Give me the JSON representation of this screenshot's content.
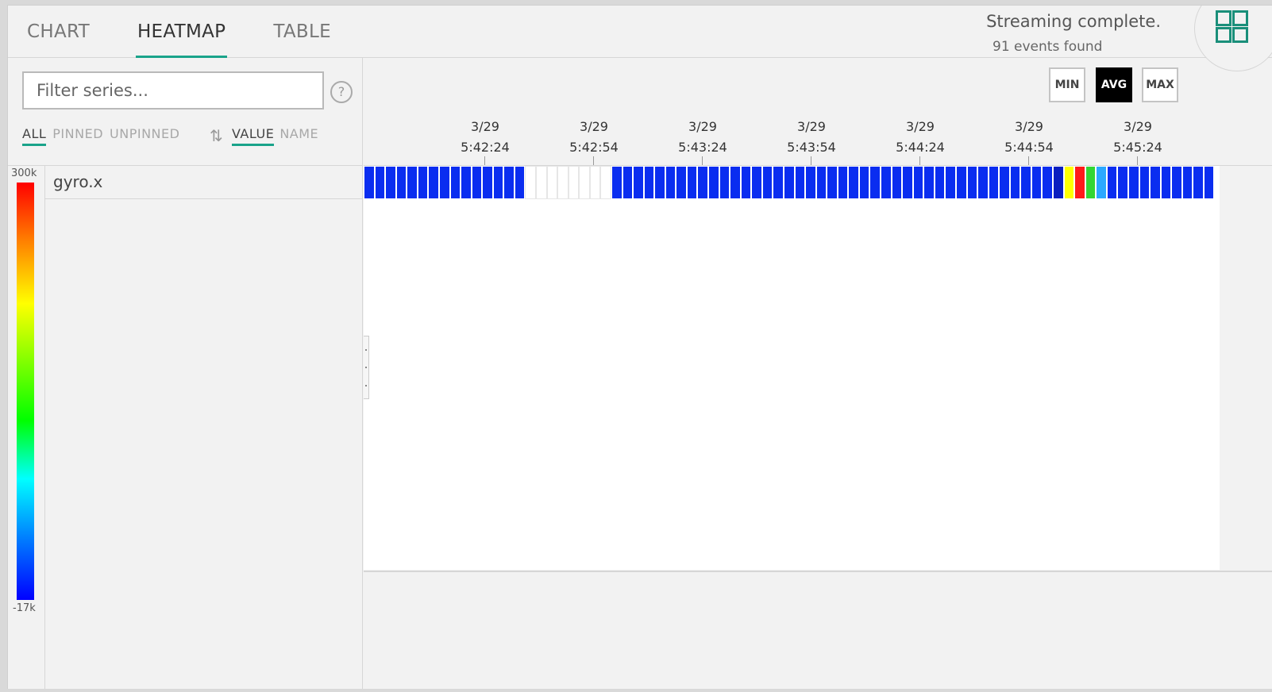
{
  "tabs": [
    {
      "label": "CHART",
      "active": false
    },
    {
      "label": "HEATMAP",
      "active": true
    },
    {
      "label": "TABLE",
      "active": false
    }
  ],
  "status": {
    "message": "Streaming complete.",
    "count": "91 events found"
  },
  "filter": {
    "placeholder": "Filter series...",
    "help": "?"
  },
  "series_filters": [
    {
      "label": "ALL",
      "active": true
    },
    {
      "label": "PINNED",
      "active": false
    },
    {
      "label": "UNPINNED",
      "active": false
    }
  ],
  "sort_options": [
    {
      "label": "VALUE",
      "active": true
    },
    {
      "label": "NAME",
      "active": false
    }
  ],
  "legend": {
    "max": "300k",
    "min": "-17k"
  },
  "series": [
    {
      "name": "gyro.x"
    }
  ],
  "aggregations": [
    {
      "label": "MIN",
      "active": false
    },
    {
      "label": "AVG",
      "active": true
    },
    {
      "label": "MAX",
      "active": false
    }
  ],
  "time_axis": [
    {
      "date": "3/29",
      "time": "5:42:24"
    },
    {
      "date": "3/29",
      "time": "5:42:54"
    },
    {
      "date": "3/29",
      "time": "5:43:24"
    },
    {
      "date": "3/29",
      "time": "5:43:54"
    },
    {
      "date": "3/29",
      "time": "5:44:24"
    },
    {
      "date": "3/29",
      "time": "5:44:54"
    },
    {
      "date": "3/29",
      "time": "5:45:24"
    }
  ],
  "colors": {
    "accent": "#1aa38a",
    "cell_low": "#0a2df0",
    "cell_dark": "#0a1fd0",
    "empty": "#ffffff"
  },
  "heatmap": {
    "cells": [
      "b",
      "b",
      "b",
      "b",
      "b",
      "b",
      "b",
      "b",
      "b",
      "b",
      "b",
      "b",
      "b",
      "b",
      "b",
      "w",
      "w",
      "w",
      "w",
      "w",
      "w",
      "w",
      "w",
      "b",
      "b",
      "b",
      "b",
      "b",
      "b",
      "b",
      "b",
      "b",
      "b",
      "b",
      "b",
      "b",
      "b",
      "b",
      "b",
      "b",
      "b",
      "b",
      "b",
      "b",
      "b",
      "b",
      "b",
      "b",
      "b",
      "b",
      "b",
      "b",
      "b",
      "b",
      "b",
      "b",
      "b",
      "b",
      "b",
      "b",
      "b",
      "b",
      "b",
      "b",
      "d",
      "y",
      "r",
      "g",
      "c",
      "b",
      "b",
      "b",
      "b",
      "b",
      "b",
      "b",
      "b",
      "b",
      "b"
    ]
  }
}
